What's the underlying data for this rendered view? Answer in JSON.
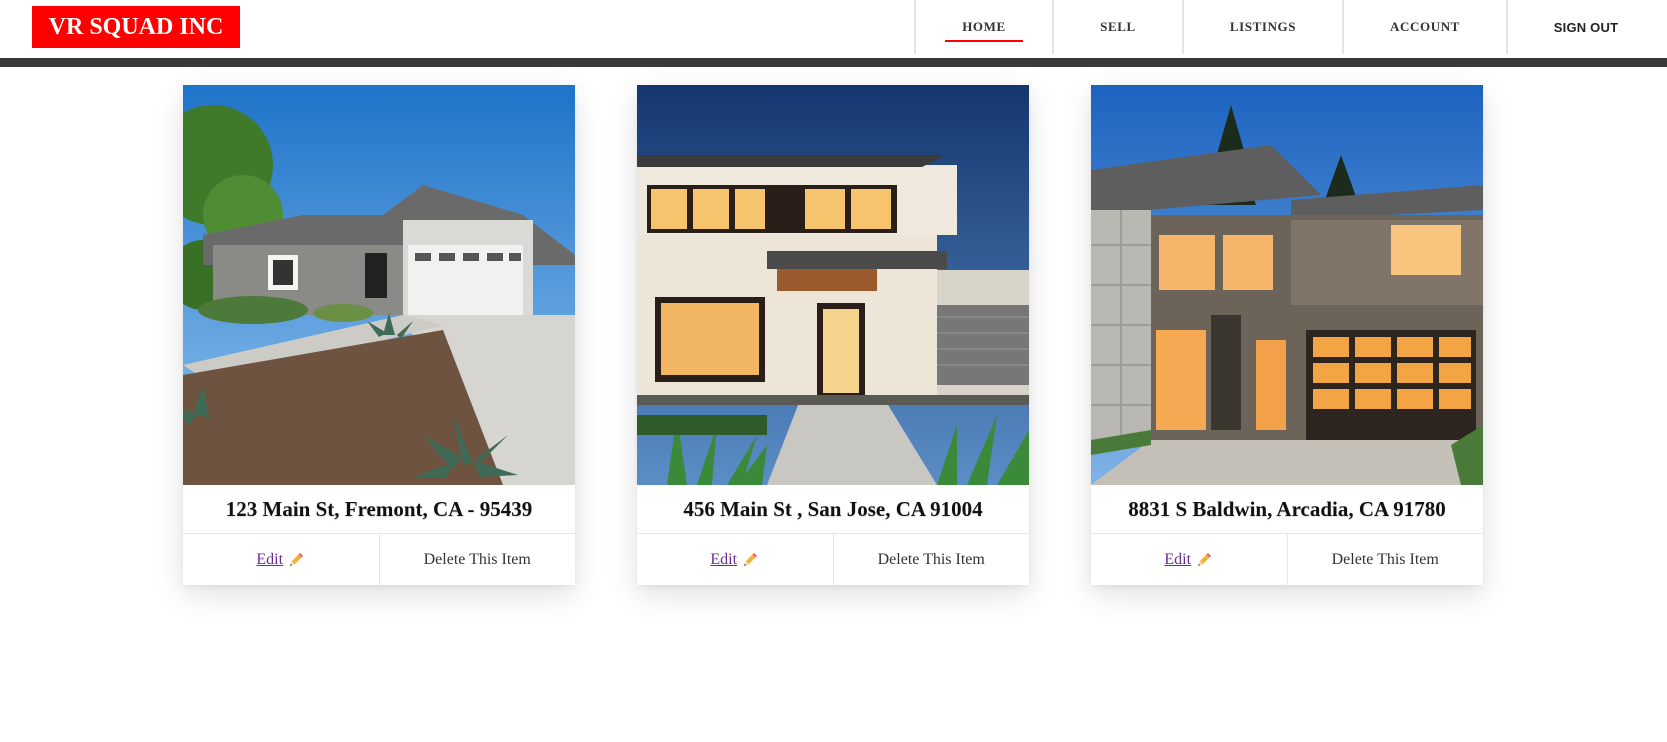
{
  "brand": {
    "name": "VR SQUAD INC",
    "color": "#ff0000"
  },
  "nav": [
    {
      "label": "HOME",
      "active": true
    },
    {
      "label": "SELL",
      "active": false
    },
    {
      "label": "LISTINGS",
      "active": false
    },
    {
      "label": "ACCOUNT",
      "active": false
    },
    {
      "label": "SIGN OUT",
      "active": false
    }
  ],
  "listings": [
    {
      "address": "123 Main St, Fremont, CA - 95439",
      "edit_label": "Edit",
      "edit_icon": "pencil-icon",
      "delete_label": "Delete This Item"
    },
    {
      "address": "456 Main St , San Jose, CA 91004",
      "edit_label": "Edit",
      "edit_icon": "pencil-icon",
      "delete_label": "Delete This Item"
    },
    {
      "address": "8831 S Baldwin, Arcadia, CA 91780",
      "edit_label": "Edit",
      "edit_icon": "pencil-icon",
      "delete_label": "Delete This Item"
    }
  ],
  "colors": {
    "accent": "#ff0000",
    "header_strip": "#3a3a3a",
    "link": "#6a2c91"
  }
}
